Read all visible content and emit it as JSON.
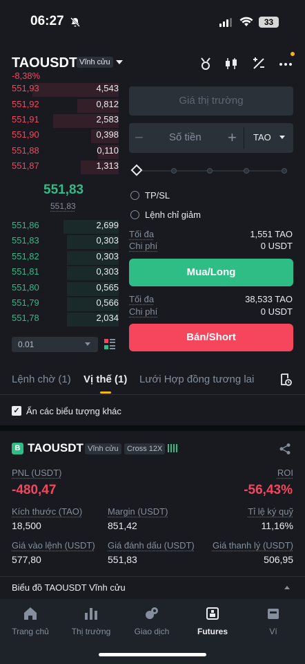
{
  "status_bar": {
    "time": "06:27",
    "battery": "33"
  },
  "header": {
    "pair": "TAOUSDT",
    "contract_type": "Vĩnh cửu",
    "change": "-8,38%",
    "icons": [
      "funding-icon",
      "candlestick-icon",
      "percent-icon",
      "more-icon"
    ]
  },
  "orderbook": {
    "asks": [
      {
        "price": "551,93",
        "qty": "4,543"
      },
      {
        "price": "551,92",
        "qty": "0,812"
      },
      {
        "price": "551,91",
        "qty": "2,583"
      },
      {
        "price": "551,90",
        "qty": "0,398"
      },
      {
        "price": "551,88",
        "qty": "0,110"
      },
      {
        "price": "551,87",
        "qty": "1,313"
      }
    ],
    "last_price": "551,83",
    "mark_price": "551,83",
    "bids": [
      {
        "price": "551,86",
        "qty": "2,699"
      },
      {
        "price": "551,83",
        "qty": "0,303"
      },
      {
        "price": "551,82",
        "qty": "0,303"
      },
      {
        "price": "551,81",
        "qty": "0,303"
      },
      {
        "price": "551,80",
        "qty": "0,565"
      },
      {
        "price": "551,79",
        "qty": "0,566"
      },
      {
        "price": "551,78",
        "qty": "2,034"
      }
    ],
    "tick_size": "0.01"
  },
  "order_form": {
    "price_placeholder": "Giá thị trường",
    "amount_placeholder": "Số tiền",
    "amount_minus": "−",
    "amount_plus": "+",
    "amount_unit": "TAO",
    "tpsl_label": "TP/SL",
    "reduce_only_label": "Lệnh chỉ giảm",
    "buy_max_label": "Tối đa",
    "buy_max_value": "1,551 TAO",
    "buy_cost_label": "Chi phí",
    "buy_cost_value": "0 USDT",
    "buy_button": "Mua/Long",
    "sell_max_label": "Tối đa",
    "sell_max_value": "38,533 TAO",
    "sell_cost_label": "Chi phí",
    "sell_cost_value": "0 USDT",
    "sell_button": "Bán/Short"
  },
  "tabs": {
    "open_orders": "Lệnh chờ (1)",
    "positions": "Vị thế (1)",
    "grid": "Lưới Hợp đồng tương lai"
  },
  "hide_others_label": "Ẩn các biểu tượng khác",
  "position": {
    "badge": "B",
    "pair": "TAOUSDT",
    "contract_type": "Vĩnh cửu",
    "margin_mode": "Cross 12X",
    "pnl_label": "PNL (USDT)",
    "pnl_value": "-480,47",
    "roi_label": "ROI",
    "roi_value": "-56,43%",
    "size_label": "Kích thước (TAO)",
    "size_value": "18,500",
    "margin_label": "Margin (USDT)",
    "margin_value": "851,42",
    "margin_ratio_label": "Tỉ lệ ký quỹ",
    "margin_ratio_value": "11,16%",
    "entry_label": "Giá vào lệnh (USDT)",
    "entry_value": "577,80",
    "mark_label": "Giá đánh dấu (USDT)",
    "mark_value": "551,83",
    "liq_label": "Giá thanh lý (USDT)",
    "liq_value": "506,95"
  },
  "chart_link": "Biểu đồ TAOUSDT Vĩnh cửu",
  "bottom_nav": [
    {
      "label": "Trang chủ",
      "icon": "home-icon"
    },
    {
      "label": "Thị trường",
      "icon": "markets-icon"
    },
    {
      "label": "Giao dịch",
      "icon": "trade-icon"
    },
    {
      "label": "Futures",
      "icon": "futures-icon"
    },
    {
      "label": "Ví",
      "icon": "wallet-icon"
    }
  ],
  "colors": {
    "up": "#2ebd85",
    "down": "#f6465d",
    "accent": "#f0b90b",
    "bg": "#181a20"
  }
}
